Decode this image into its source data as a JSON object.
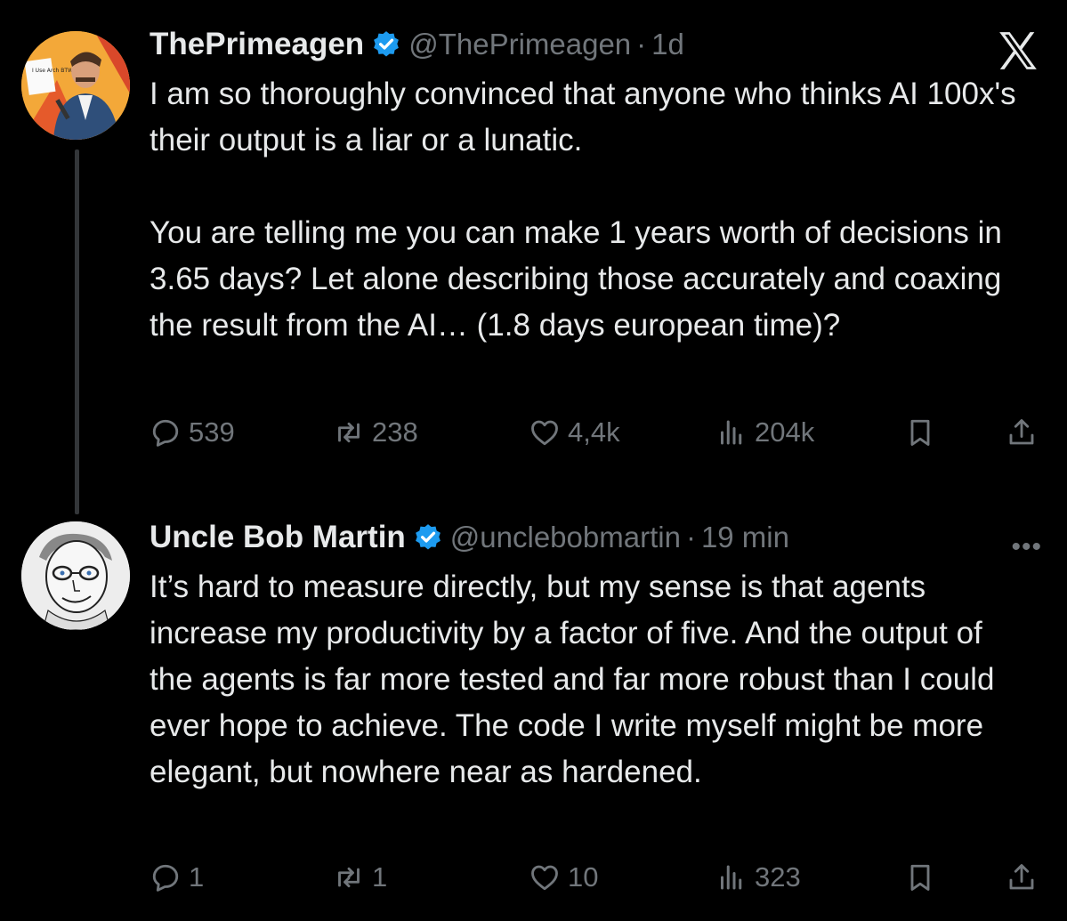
{
  "tweets": [
    {
      "name": "ThePrimeagen",
      "handle": "@ThePrimeagen",
      "separator": "·",
      "time": "1d",
      "avatar_sign_text": "I Use Arch BTW",
      "body": "I am so thoroughly convinced that anyone who thinks AI 100x's their output is a liar or a lunatic.\n\nYou are telling me you can make 1 years worth of decisions in 3.65 days? Let alone describing those accurately and coaxing the result from the AI… (1.8 days european time)?",
      "replies": "539",
      "reposts": "238",
      "likes": "4,4k",
      "views": "204k"
    },
    {
      "name": "Uncle Bob Martin",
      "handle": "@unclebobmartin",
      "separator": "·",
      "time": "19 min",
      "body": "It’s hard to measure directly, but my sense is that agents increase my productivity by a factor of five. And the output of the agents is far more tested and far more robust than I could ever hope to achieve. The code I write myself might be more elegant, but nowhere near as hardened.",
      "replies": "1",
      "reposts": "1",
      "likes": "10",
      "views": "323"
    }
  ],
  "more_label": "•••",
  "icons": [
    "x-logo-icon",
    "verified-badge-icon",
    "reply-icon",
    "repost-icon",
    "like-icon",
    "views-icon",
    "bookmark-icon",
    "share-icon",
    "more-icon"
  ],
  "colors": {
    "background": "#000000",
    "text": "#e7e9ea",
    "muted": "#71767b",
    "verified": "#1d9bf0",
    "thread_line": "#333639"
  }
}
